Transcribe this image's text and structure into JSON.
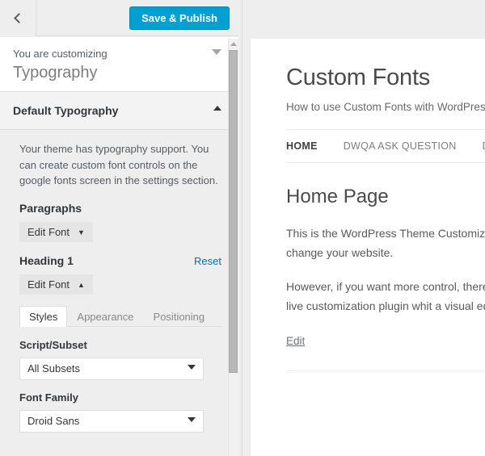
{
  "customizer": {
    "back_label": "Back",
    "save_label": "Save & Publish",
    "panel": {
      "eyebrow": "You are customizing",
      "title": "Typography"
    },
    "section": {
      "label": "Default Typography"
    },
    "description": "Your theme has typography support. You can create custom font controls on the google fonts screen in the settings section.",
    "controls": [
      {
        "label": "Paragraphs",
        "button": "Edit Font",
        "caret": "▼",
        "reset": ""
      },
      {
        "label": "Heading 1",
        "button": "Edit Font",
        "caret": "▲",
        "reset": "Reset"
      }
    ],
    "tabs": [
      {
        "label": "Styles",
        "active": true
      },
      {
        "label": "Appearance",
        "active": false
      },
      {
        "label": "Positioning",
        "active": false
      }
    ],
    "fields": [
      {
        "label": "Script/Subset",
        "value": "All Subsets"
      },
      {
        "label": "Font Family",
        "value": "Droid Sans"
      }
    ],
    "colors": {
      "accent": "#00a0d2",
      "link": "#0073aa",
      "panel_bg": "#eeeeee",
      "section_bg": "#f3f3f3",
      "text": "#32373c",
      "muted": "#555d66"
    }
  },
  "preview": {
    "site_title": "Custom Fonts",
    "tagline": "How to use Custom Fonts with WordPress",
    "nav": [
      {
        "label": "HOME",
        "current": true
      },
      {
        "label": "DWQA ASK QUESTION",
        "current": false
      },
      {
        "label": "DW",
        "current": false
      }
    ],
    "post_title": "Home Page",
    "paragraph_1": "This is the WordPress Theme Customizer, you can use it to change your website.",
    "paragraph_2": "However, if you want more control, there is an alternative: a live customization plugin whit a visual editor.",
    "edit_label": "Edit"
  }
}
